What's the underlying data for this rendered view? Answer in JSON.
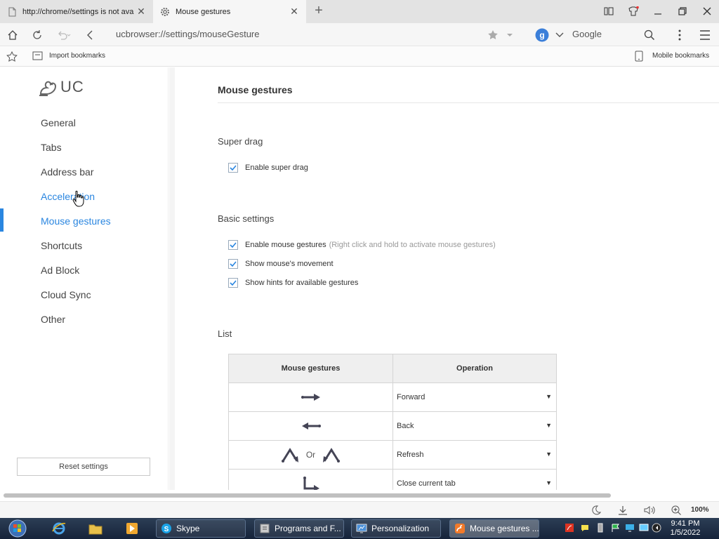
{
  "browser": {
    "tabs": [
      {
        "title": "http://chrome//settings is not ava",
        "icon": "page-icon",
        "active": false
      },
      {
        "title": "Mouse gestures",
        "icon": "gear-icon",
        "active": true
      }
    ],
    "url": "ucbrowser://settings/mouseGesture",
    "search_engine": "Google",
    "accent": "#2a86e0"
  },
  "bookmarks": {
    "import_label": "Import bookmarks",
    "mobile_label": "Mobile bookmarks"
  },
  "sidebar": {
    "logo": "UC",
    "items": [
      {
        "label": "General"
      },
      {
        "label": "Tabs"
      },
      {
        "label": "Address bar"
      },
      {
        "label": "Acceleration"
      },
      {
        "label": "Mouse gestures"
      },
      {
        "label": "Shortcuts"
      },
      {
        "label": "Ad Block"
      },
      {
        "label": "Cloud Sync"
      },
      {
        "label": "Other"
      }
    ],
    "active": "Mouse gestures",
    "reset_label": "Reset settings"
  },
  "main": {
    "title": "Mouse gestures",
    "super_drag": {
      "heading": "Super drag",
      "enable_label": "Enable super drag",
      "checked": true
    },
    "basic": {
      "heading": "Basic settings",
      "options": [
        {
          "label": "Enable mouse gestures",
          "hint": "(Right click and hold to activate mouse gestures)",
          "checked": true
        },
        {
          "label": "Show mouse's movement",
          "hint": "",
          "checked": true
        },
        {
          "label": "Show hints for available gestures",
          "hint": "",
          "checked": true
        }
      ]
    },
    "list": {
      "heading": "List",
      "col_gesture": "Mouse gestures",
      "col_operation": "Operation",
      "or_label": "Or",
      "rows": [
        {
          "gesture": "arrow-right-icon",
          "operation": "Forward"
        },
        {
          "gesture": "arrow-left-icon",
          "operation": "Back"
        },
        {
          "gesture": "up-down-gesture-icon",
          "operation": "Refresh"
        },
        {
          "gesture": "down-right-gesture-icon",
          "operation": "Close current tab"
        }
      ]
    }
  },
  "statusbar": {
    "zoom": "100%"
  },
  "taskbar": {
    "buttons": [
      {
        "label": "Skype",
        "active": false
      },
      {
        "label": "Programs and F...",
        "active": false
      },
      {
        "label": "Personalization",
        "active": false
      },
      {
        "label": "Mouse gestures ...",
        "active": true
      }
    ],
    "time": "9:41 PM",
    "date": "1/5/2022"
  }
}
